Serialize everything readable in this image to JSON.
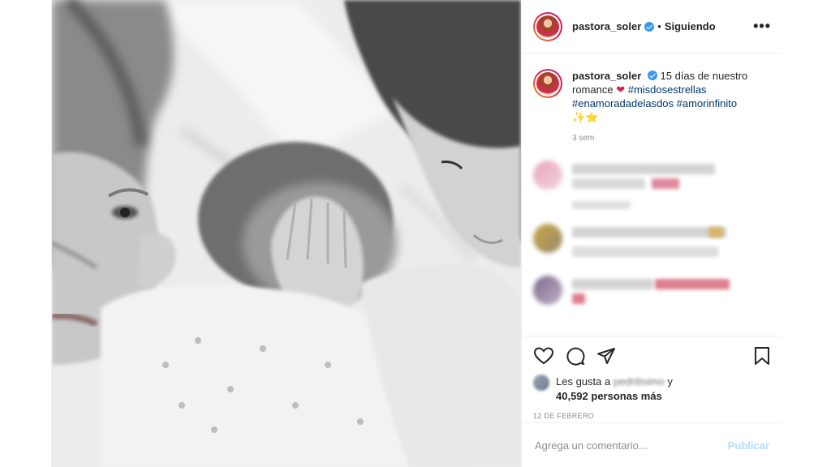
{
  "post": {
    "username": "pastora_soler",
    "follow_separator": "•",
    "follow_status": "Siguiendo",
    "more_label": "•••",
    "caption_text": "15 días de nuestro romance",
    "caption_emoji_heart": "❤",
    "hashtags": [
      "#misdosestrellas",
      "#enamoradadelasdos",
      "#amorinfinito"
    ],
    "caption_emojis": "✨⭐",
    "caption_age": "3 sem",
    "likes_prefix": "Les gusta a",
    "likes_blurred_name": "pedritisimo",
    "likes_suffix": "y",
    "likes_count": "40,592 personas más",
    "date": "12 DE FEBRERO",
    "comment_placeholder": "Agrega un comentario...",
    "publish_label": "Publicar"
  },
  "colors": {
    "link": "#00376b",
    "verified": "#3897f0",
    "publish_disabled": "#b3dbff",
    "muted": "#8e8e8e"
  },
  "icons": [
    "heart-icon",
    "comment-icon",
    "share-icon",
    "bookmark-icon",
    "more-options-icon",
    "verified-badge-icon"
  ]
}
